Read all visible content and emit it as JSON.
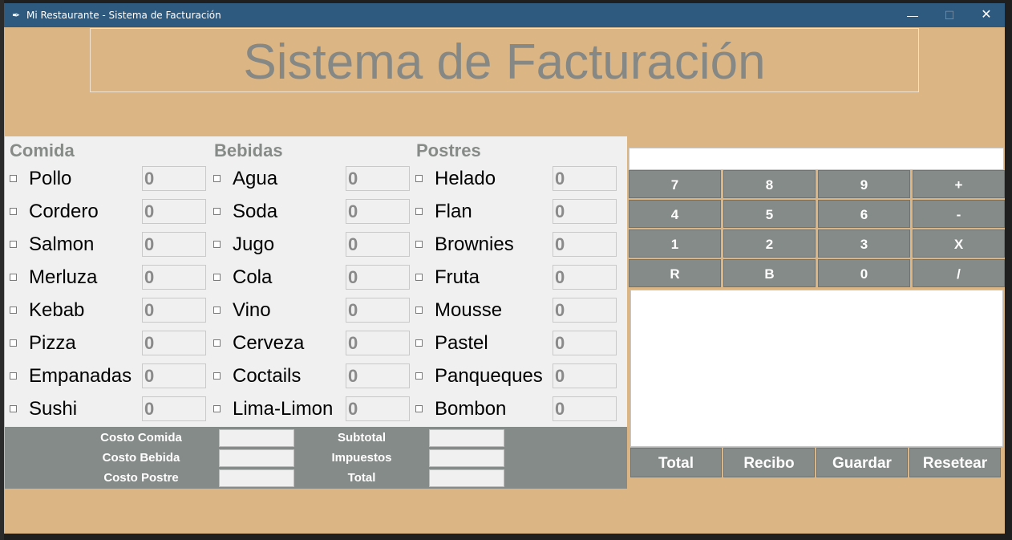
{
  "window": {
    "title": "Mi Restaurante - Sistema de Facturación",
    "icon": "feather-icon",
    "controls": {
      "minimize": "—",
      "maximize": "☐",
      "close": "✕"
    }
  },
  "header": {
    "title": "Sistema de Facturación"
  },
  "categories": [
    {
      "title": "Comida",
      "items": [
        {
          "label": "Pollo",
          "qty": "0"
        },
        {
          "label": "Cordero",
          "qty": "0"
        },
        {
          "label": "Salmon",
          "qty": "0"
        },
        {
          "label": "Merluza",
          "qty": "0"
        },
        {
          "label": "Kebab",
          "qty": "0"
        },
        {
          "label": "Pizza",
          "qty": "0"
        },
        {
          "label": "Empanadas",
          "qty": "0"
        },
        {
          "label": "Sushi",
          "qty": "0"
        }
      ]
    },
    {
      "title": "Bebidas",
      "items": [
        {
          "label": "Agua",
          "qty": "0"
        },
        {
          "label": "Soda",
          "qty": "0"
        },
        {
          "label": "Jugo",
          "qty": "0"
        },
        {
          "label": "Cola",
          "qty": "0"
        },
        {
          "label": "Vino",
          "qty": "0"
        },
        {
          "label": "Cerveza",
          "qty": "0"
        },
        {
          "label": "Coctails",
          "qty": "0"
        },
        {
          "label": "Lima-Limon",
          "qty": "0"
        }
      ]
    },
    {
      "title": "Postres",
      "items": [
        {
          "label": "Helado",
          "qty": "0"
        },
        {
          "label": "Flan",
          "qty": "0"
        },
        {
          "label": "Brownies",
          "qty": "0"
        },
        {
          "label": "Fruta",
          "qty": "0"
        },
        {
          "label": "Mousse",
          "qty": "0"
        },
        {
          "label": "Pastel",
          "qty": "0"
        },
        {
          "label": "Panqueques",
          "qty": "0"
        },
        {
          "label": "Bombon",
          "qty": "0"
        }
      ]
    }
  ],
  "costs": {
    "costo_comida": "Costo Comida",
    "costo_bebida": "Costo Bebida",
    "costo_postre": "Costo Postre",
    "subtotal": "Subtotal",
    "impuestos": "Impuestos",
    "total": "Total"
  },
  "calculator": {
    "keys": [
      "7",
      "8",
      "9",
      "+",
      "4",
      "5",
      "6",
      "-",
      "1",
      "2",
      "3",
      "X",
      "R",
      "B",
      "0",
      "/"
    ]
  },
  "actions": [
    "Total",
    "Recibo",
    "Guardar",
    "Resetear"
  ],
  "colors": {
    "background": "#dcb584",
    "button": "#858b88",
    "titlebar": "#2e5a80"
  }
}
